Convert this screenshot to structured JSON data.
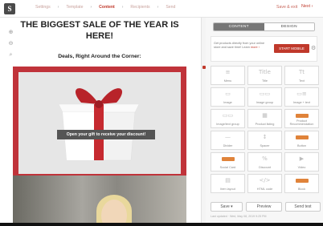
{
  "nav": {
    "steps": [
      "Settings",
      "Template",
      "Content",
      "Recipients",
      "Send"
    ],
    "active_step": 2,
    "save_exit": "Save & exit",
    "next": "Next"
  },
  "tools": [
    "zoom-in-icon",
    "zoom-out-icon",
    "search-icon"
  ],
  "email": {
    "title": "THE BIGGEST SALE OF THE YEAR IS HERE!",
    "deals": "Deals, Right Around the Corner:",
    "banner": "Open your gift to receive your discount!"
  },
  "sidebar": {
    "tabs": [
      "CONTENT",
      "DESIGN"
    ],
    "active_tab": 0,
    "promo_text": "Get products directly from your online store and save time! Learn ",
    "promo_link": "more ›",
    "promo_button": "START MOBILE",
    "blocks": [
      {
        "label": "Menu",
        "icon": "≡"
      },
      {
        "label": "Title",
        "icon": "Title"
      },
      {
        "label": "Text",
        "icon": "Tt"
      },
      {
        "label": "Image",
        "icon": "▭"
      },
      {
        "label": "Image group",
        "icon": "▭▭"
      },
      {
        "label": "Image + text",
        "icon": "▭≡"
      },
      {
        "label": "Image/text group",
        "icon": "▭▭"
      },
      {
        "label": "Product listing",
        "icon": "▦"
      },
      {
        "label": "Product Recommendation",
        "icon": "bar"
      },
      {
        "label": "Divider",
        "icon": "—"
      },
      {
        "label": "Spacer",
        "icon": "↕"
      },
      {
        "label": "Button",
        "icon": "bar"
      },
      {
        "label": "Social Card",
        "icon": "bar"
      },
      {
        "label": "Discount",
        "icon": "%"
      },
      {
        "label": "Video",
        "icon": "▶"
      },
      {
        "label": "Item layout",
        "icon": "▤"
      },
      {
        "label": "HTML code",
        "icon": "</>"
      },
      {
        "label": "Block",
        "icon": "bar"
      }
    ],
    "buttons": [
      "Save",
      "Preview",
      "Send test"
    ],
    "footer_note": "Last updated · Wed, May 08, 2019 9:25 PM"
  },
  "colors": {
    "accent": "#c0392b",
    "gift_frame": "#c0333a"
  }
}
